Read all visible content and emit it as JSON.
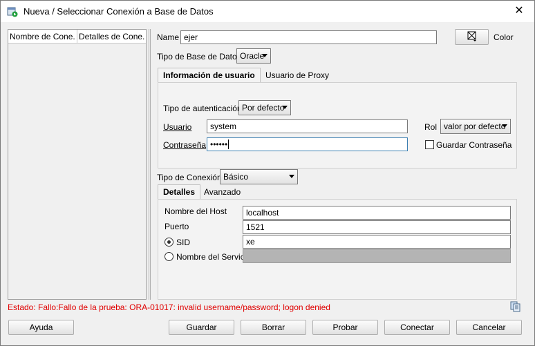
{
  "window": {
    "title": "Nueva / Seleccionar Conexión a Base de Datos"
  },
  "list": {
    "col1": "Nombre de Cone...",
    "col2": "Detalles de Cone..."
  },
  "form": {
    "name_label": "Name",
    "name_value": "ejer",
    "color_label": "Color",
    "db_type_label": "Tipo de Base de Datos",
    "db_type_value": "Oracle",
    "tab_user_info": "Información de usuario",
    "tab_proxy": "Usuario de Proxy",
    "auth_type_label": "Tipo de autenticación",
    "auth_type_value": "Por defecto",
    "user_label": "Usuario",
    "user_value": "system",
    "role_label": "Rol",
    "role_value": "valor por defecto",
    "password_label": "Contraseña",
    "password_value": "••••••",
    "save_password_label": "Guardar Contraseña",
    "conn_type_label": "Tipo de Conexión",
    "conn_type_value": "Básico",
    "tab_details": "Detalles",
    "tab_advanced": "Avanzado",
    "host_label": "Nombre del Host",
    "host_value": "localhost",
    "port_label": "Puerto",
    "port_value": "1521",
    "sid_label": "SID",
    "sid_value": "xe",
    "service_label": "Nombre del Servicio",
    "service_value": ""
  },
  "status": {
    "text": "Estado: Fallo:Fallo de la prueba: ORA-01017: invalid username/password; logon denied",
    "color": "#e00000"
  },
  "buttons": {
    "help": "Ayuda",
    "save": "Guardar",
    "delete": "Borrar",
    "test": "Probar",
    "connect": "Conectar",
    "cancel": "Cancelar"
  }
}
